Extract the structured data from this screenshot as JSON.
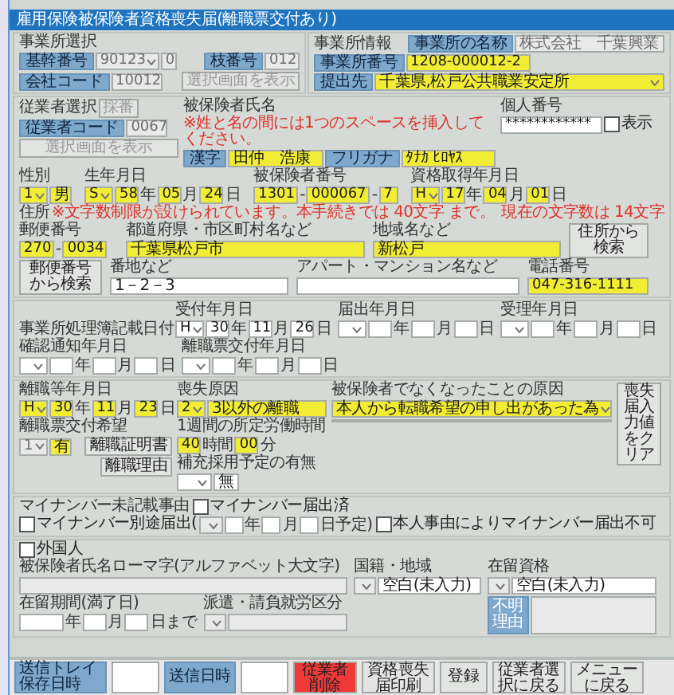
{
  "window": {
    "title": "雇用保険被保険者資格喪失届(離職票交付あり)"
  },
  "office_select": {
    "heading": "事業所選択",
    "base_no_label": "基幹番号",
    "base_no": {
      "value": "90123",
      "disabled": true
    },
    "base_no_suffix": {
      "value": "0",
      "disabled": true
    },
    "branch_label": "枝番号",
    "branch_no": {
      "value": "012",
      "disabled": true
    },
    "company_code_label": "会社コード",
    "company_code": {
      "value": "10012",
      "disabled": true
    },
    "select_button": {
      "label": "選択画面を表示",
      "disabled": true
    }
  },
  "office_info": {
    "heading": "事業所情報",
    "name_label": "事業所の名称",
    "name": {
      "value": "株式会社　千葉興業",
      "disabled": true
    },
    "number_label": "事業所番号",
    "number": {
      "value": "1208-000012-2",
      "highlighted": true
    },
    "submit_label": "提出先",
    "submit_to": {
      "value": "千葉県,松戸公共職業安定所",
      "highlighted": true
    }
  },
  "employee_select": {
    "heading": "従業者選択",
    "number_button": {
      "label": "採番",
      "disabled": true
    },
    "code_label": "従業者コード",
    "code": {
      "value": "0067",
      "disabled": true
    },
    "select_button": {
      "label": "選択画面を表示",
      "disabled": true
    }
  },
  "name": {
    "heading": "被保険者氏名",
    "note": "※姓と名の間には1つのスペースを挿入してください。",
    "kanji_label": "漢字",
    "kanji": {
      "value": "田仲　浩康",
      "highlighted": true
    },
    "kana_label": "フリガナ",
    "kana": {
      "value": "ﾀﾅｶ ﾋﾛﾔｽ",
      "highlighted": true
    }
  },
  "my_number": {
    "heading": "個人番号",
    "value": {
      "value": "************"
    },
    "show": {
      "label": "表示",
      "checked": false
    }
  },
  "sex": {
    "heading": "性別",
    "code": {
      "value": "1",
      "highlighted": true
    },
    "text": {
      "value": "男",
      "highlighted": true
    }
  },
  "birth": {
    "heading": "生年月日",
    "date": {
      "kind": "era",
      "era": {
        "value": "S",
        "highlighted": true
      },
      "year": {
        "value": "58",
        "highlighted": true
      },
      "month": {
        "value": "05",
        "highlighted": true
      },
      "day": {
        "value": "24",
        "highlighted": true
      },
      "units": [
        "年",
        "月",
        "日"
      ]
    }
  },
  "insured_number": {
    "heading": "被保険者番号",
    "parts": [
      {
        "value": "1301",
        "highlighted": true
      },
      {
        "value": "000067",
        "highlighted": true
      },
      {
        "value": "7",
        "highlighted": true
      }
    ],
    "separators": [
      "-",
      "-"
    ]
  },
  "acquired": {
    "heading": "資格取得年月日",
    "date": {
      "kind": "era",
      "era": {
        "value": "H",
        "highlighted": true
      },
      "year": {
        "value": "17",
        "highlighted": true
      },
      "month": {
        "value": "04",
        "highlighted": true
      },
      "day": {
        "value": "01",
        "highlighted": true
      },
      "units": [
        "年",
        "月",
        "日"
      ]
    }
  },
  "address": {
    "heading": "住所",
    "note": "※文字数制限が設けられています。本手続きでは 40文字 まで。",
    "count_note": "現在の文字数は 14文字",
    "postal_label": "郵便番号",
    "postal": [
      {
        "value": "270",
        "highlighted": true
      },
      {
        "value": "0034",
        "highlighted": true
      }
    ],
    "postal_sep": "-",
    "pref_label": "都道府県・市区町村名など",
    "pref": {
      "value": "千葉県松戸市",
      "highlighted": true
    },
    "area_label": "地域名など",
    "area": {
      "value": "新松戸",
      "highlighted": true
    },
    "search_address_button": "住所から検索",
    "search_postal_button": "郵便番号から検索",
    "street_label": "番地など",
    "street": {
      "value": "1－2－3"
    },
    "building_label": "アパート・マンション名など",
    "phone_label": "電話番号",
    "phone": {
      "value": "047-316-1111",
      "highlighted": true
    }
  },
  "processing_dates": {
    "heading": "事業所処理簿記載日付",
    "items": [
      {
        "label": "受付年月日",
        "date": {
          "kind": "era",
          "era": {
            "value": "H"
          },
          "year": {
            "value": "30"
          },
          "month": {
            "value": "11"
          },
          "day": {
            "value": "26"
          },
          "units": [
            "年",
            "月",
            "日"
          ]
        }
      },
      {
        "label": "届出年月日",
        "date": {
          "kind": "era",
          "units": [
            "年",
            "月",
            "日"
          ]
        }
      },
      {
        "label": "受理年月日",
        "date": {
          "kind": "era",
          "units": [
            "年",
            "月",
            "日"
          ]
        }
      },
      {
        "label": "確認通知年月日",
        "date": {
          "kind": "era",
          "units": [
            "年",
            "月",
            "日"
          ]
        }
      },
      {
        "label": "離職票交付年月日",
        "date": {
          "kind": "era",
          "units": [
            "年",
            "月",
            "日"
          ]
        }
      }
    ]
  },
  "loss": {
    "separation_date_label": "離職等年月日",
    "separation_date": {
      "kind": "era",
      "era": {
        "value": "H",
        "highlighted": true
      },
      "year": {
        "value": "30",
        "highlighted": true
      },
      "month": {
        "value": "11",
        "highlighted": true
      },
      "day": {
        "value": "23",
        "highlighted": true
      },
      "units": [
        "年",
        "月",
        "日"
      ]
    },
    "cause_label": "喪失原因",
    "cause_code": {
      "value": "2",
      "highlighted": true
    },
    "cause_text": {
      "value": "3以外の離職",
      "highlighted": true
    },
    "reason_label": "被保険者でなくなったことの原因",
    "reason": {
      "value": "本人から転職希望の申し出があった為",
      "highlighted": true
    },
    "clear_button": "喪失届入力値をクリア",
    "slip_label": "離職票交付希望",
    "slip_code": {
      "value": "1",
      "disabled": true
    },
    "slip_text": {
      "value": "有",
      "highlighted": true
    },
    "certificate_button": "離職証明書",
    "reason_button": "離職理由",
    "hours_label": "1週間の所定労働時間",
    "hours": {
      "value": "40",
      "highlighted": true
    },
    "hours_unit": "時間",
    "minutes": {
      "value": "00",
      "highlighted": true
    },
    "minutes_unit": "分",
    "replacement_label": "補充採用予定の有無",
    "replacement_text": {
      "value": "無"
    }
  },
  "mynumber_reason": {
    "heading": "マイナンバー未記載事由",
    "options": [
      {
        "kind": "plain",
        "label": "マイナンバー届出済",
        "checked": false
      },
      {
        "kind": "with_date",
        "label": "マイナンバー別途届出(",
        "checked": false,
        "date": {
          "kind": "era",
          "era": {
            "disabled": true
          },
          "units": [
            "年",
            "月",
            "日予定)"
          ]
        }
      },
      {
        "kind": "plain",
        "label": "本人事由によりマイナンバー届出不可",
        "checked": false
      }
    ]
  },
  "foreign": {
    "checkbox": {
      "label": "外国人",
      "checked": false
    },
    "roman_label": "被保険者氏名ローマ字(アルファベット大文字)",
    "roman": {
      "disabled": true
    },
    "nationality_label": "国籍・地域",
    "nationality_code": {
      "disabled": true
    },
    "nationality": {
      "value": "空白(未入力)"
    },
    "status_label": "在留資格",
    "status_code": {
      "disabled": true
    },
    "status": {
      "value": "空白(未入力)"
    },
    "period_label": "在留期間(満了日)",
    "period": {
      "kind": "plain",
      "units": [
        "年",
        "月",
        "日まで"
      ]
    },
    "dispatch_label": "派遣・請負就労区分",
    "dispatch_code": {
      "disabled": true
    },
    "dispatch_text": {
      "disabled": true
    },
    "unknown_reason_label": "不明理由",
    "unknown_reason": {
      "disabled": true
    }
  },
  "footer": {
    "tray_label": "送信トレイ保存日時",
    "sent_label": "送信日時",
    "buttons": [
      {
        "label": "従業者削除",
        "kind": "danger"
      },
      {
        "label": "資格喪失届印刷",
        "kind": "normal"
      },
      {
        "label": "登録",
        "kind": "normal"
      },
      {
        "label": "従業者選択に戻る",
        "kind": "normal"
      },
      {
        "label": "メニューに戻る",
        "kind": "normal"
      }
    ]
  }
}
